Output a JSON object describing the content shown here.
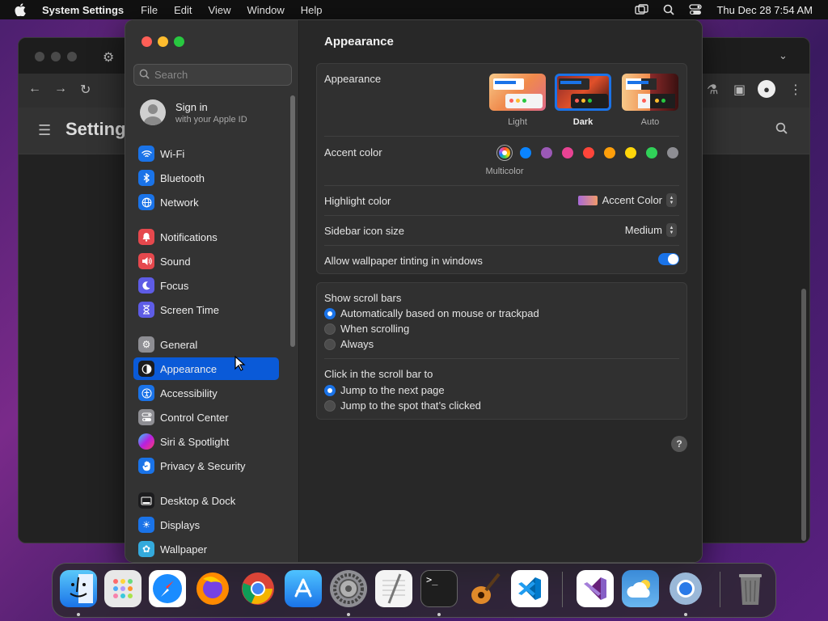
{
  "menubar": {
    "app_name": "System Settings",
    "items": [
      "File",
      "Edit",
      "View",
      "Window",
      "Help"
    ],
    "clock": "Thu Dec 28  7:54 AM"
  },
  "background_window": {
    "title": "Setting"
  },
  "settings": {
    "search": {
      "placeholder": "Search"
    },
    "account": {
      "title": "Sign in",
      "subtitle": "with your Apple ID"
    },
    "sidebar": [
      {
        "label": "Wi-Fi",
        "icon": "wifi-icon",
        "color": "#1a73e8"
      },
      {
        "label": "Bluetooth",
        "icon": "bluetooth-icon",
        "color": "#1a73e8"
      },
      {
        "label": "Network",
        "icon": "globe-icon",
        "color": "#1a73e8"
      },
      {
        "label": "Notifications",
        "icon": "bell-icon",
        "color": "#e5484d"
      },
      {
        "label": "Sound",
        "icon": "speaker-icon",
        "color": "#e5484d"
      },
      {
        "label": "Focus",
        "icon": "moon-icon",
        "color": "#5e5ce6"
      },
      {
        "label": "Screen Time",
        "icon": "hourglass-icon",
        "color": "#5e5ce6"
      },
      {
        "label": "General",
        "icon": "gear-icon",
        "color": "#8e8e93"
      },
      {
        "label": "Appearance",
        "icon": "appearance-icon",
        "color": "#1c1c1e",
        "selected": true
      },
      {
        "label": "Accessibility",
        "icon": "accessibility-icon",
        "color": "#1a73e8"
      },
      {
        "label": "Control Center",
        "icon": "control-center-icon",
        "color": "#8e8e93"
      },
      {
        "label": "Siri & Spotlight",
        "icon": "siri-icon",
        "color": "#7a3fd0"
      },
      {
        "label": "Privacy & Security",
        "icon": "hand-icon",
        "color": "#1a73e8"
      },
      {
        "label": "Desktop & Dock",
        "icon": "dock-icon",
        "color": "#1c1c1e"
      },
      {
        "label": "Displays",
        "icon": "sun-icon",
        "color": "#1a73e8"
      },
      {
        "label": "Wallpaper",
        "icon": "flower-icon",
        "color": "#34aadc"
      }
    ],
    "main": {
      "title": "Appearance",
      "appearance_label": "Appearance",
      "modes": [
        "Light",
        "Dark",
        "Auto"
      ],
      "selected_mode": "Dark",
      "accent_label": "Accent color",
      "accent_colors": [
        "multicolor",
        "#0a84ff",
        "#9b59b6",
        "#e84393",
        "#ff453a",
        "#ff9f0a",
        "#ffd60a",
        "#30d158",
        "#8e8e93"
      ],
      "multicolor_label": "Multicolor",
      "highlight_label": "Highlight color",
      "highlight_value": "Accent Color",
      "sidebar_icon_label": "Sidebar icon size",
      "sidebar_icon_value": "Medium",
      "wallpaper_tinting_label": "Allow wallpaper tinting in windows",
      "wallpaper_tinting_on": true,
      "scroll_bars_label": "Show scroll bars",
      "scroll_bars_options": [
        "Automatically based on mouse or trackpad",
        "When scrolling",
        "Always"
      ],
      "scroll_bars_selected": 0,
      "click_label": "Click in the scroll bar to",
      "click_options": [
        "Jump to the next page",
        "Jump to the spot that’s clicked"
      ],
      "click_selected": 0,
      "help": "?"
    }
  },
  "dock": {
    "apps": [
      "Finder",
      "Launchpad",
      "Safari",
      "Firefox",
      "Chrome",
      "App Store",
      "System Settings",
      "TextEdit",
      "Terminal",
      "GarageBand",
      "VS Code",
      "Visual Studio",
      "Weather",
      "Chrome Canary",
      "Trash"
    ]
  }
}
